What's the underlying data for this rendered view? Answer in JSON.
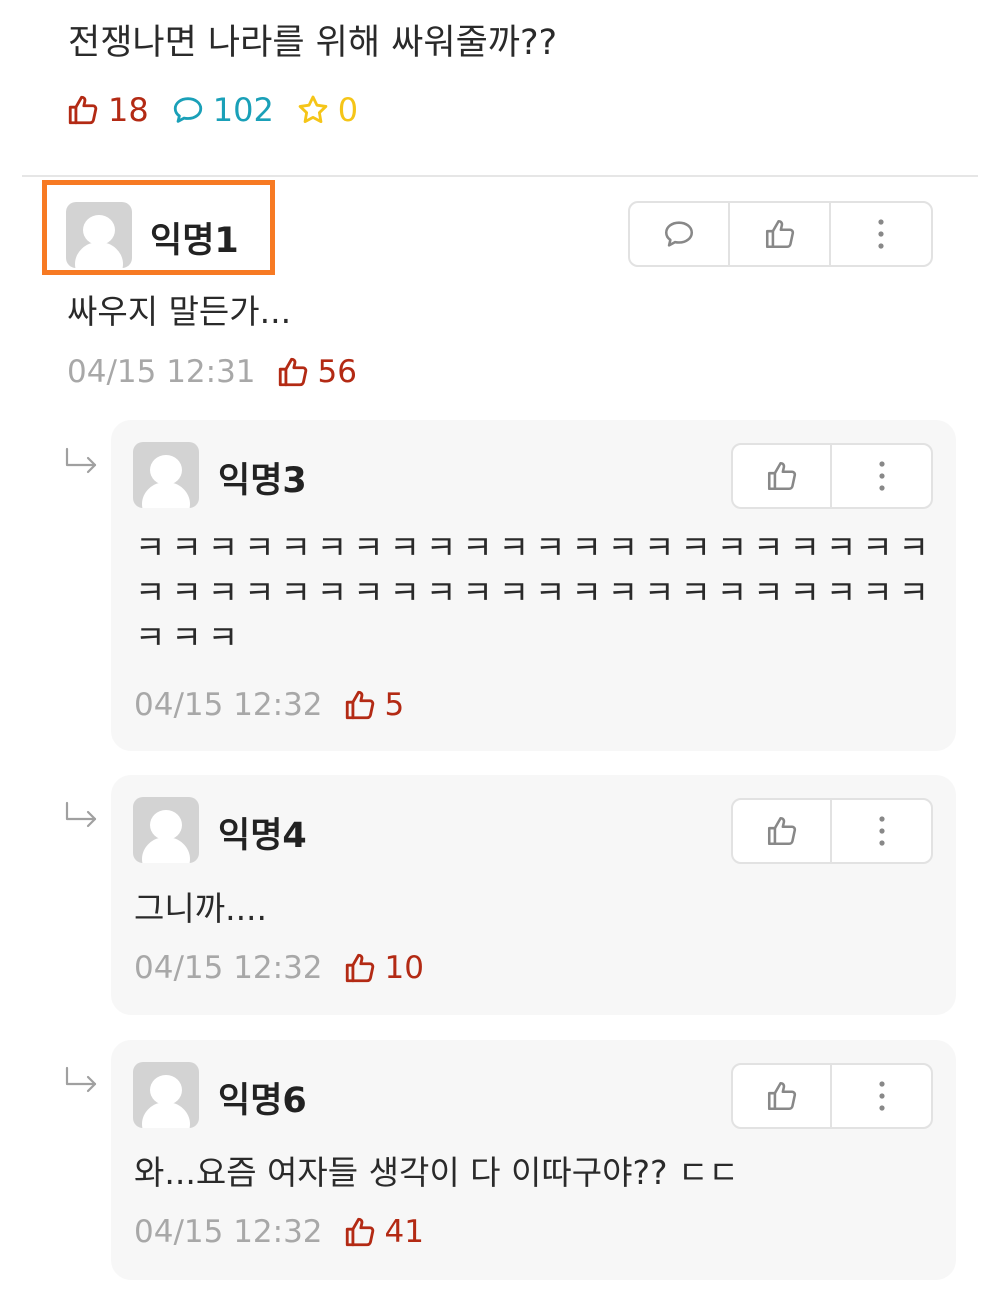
{
  "post": {
    "title": "전쟁나면 나라를 위해 싸워줄까??",
    "likes": "18",
    "comments": "102",
    "scraps": "0"
  },
  "comments": [
    {
      "author": "익명1",
      "text": "싸우지 말든가...",
      "time": "04/15 12:31",
      "likes": "56"
    }
  ],
  "replies": [
    {
      "author": "익명3",
      "text": "ㅋㅋㅋㅋㅋㅋㅋㅋㅋㅋㅋㅋㅋㅋㅋㅋㅋㅋㅋㅋㅋㅋㅋㅋㅋㅋㅋㅋㅋㅋㅋㅋㅋㅋㅋㅋㅋㅋㅋㅋㅋㅋㅋㅋㅋㅋㅋ",
      "time": "04/15 12:32",
      "likes": "5"
    },
    {
      "author": "익명4",
      "text": "그니까....",
      "time": "04/15 12:32",
      "likes": "10"
    },
    {
      "author": "익명6",
      "text": "와...요즘 여자들 생각이 다 이따구야?? ㄷㄷ",
      "time": "04/15 12:32",
      "likes": "41"
    }
  ],
  "colors": {
    "like": "#b32a14",
    "comment": "#1aa0b8",
    "scrap": "#f5c518",
    "highlight": "#f77a23",
    "reply_bg": "#f7f7f7"
  },
  "icons": [
    "thumbs-up-icon",
    "speech-bubble-icon",
    "star-icon",
    "more-vertical-icon",
    "reply-arrow-icon"
  ]
}
